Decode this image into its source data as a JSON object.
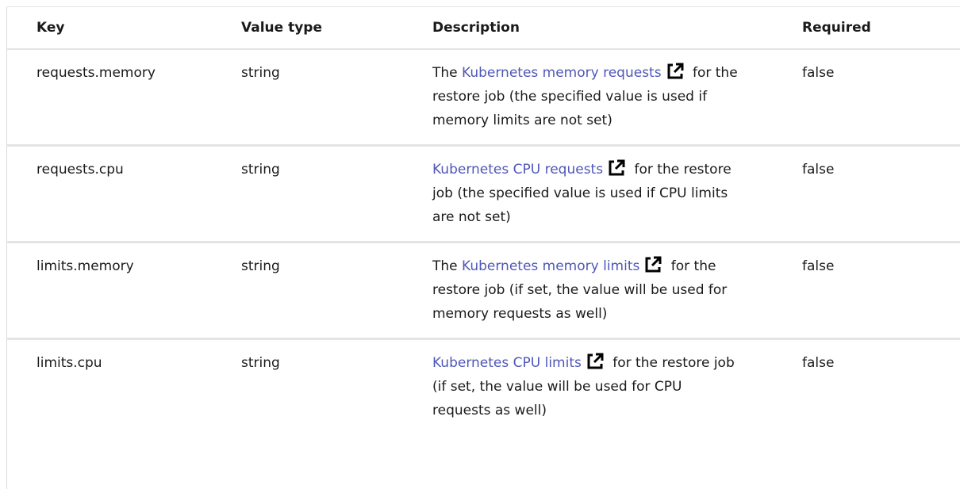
{
  "table": {
    "headers": {
      "key": "Key",
      "value_type": "Value type",
      "description": "Description",
      "required": "Required"
    },
    "rows": [
      {
        "key": "requests.memory",
        "value_type": "string",
        "desc_prefix": "The ",
        "link_text": "Kubernetes memory requests",
        "desc_suffix": " for the restore job (the specified value is used if memory limits are not set)",
        "required": "false"
      },
      {
        "key": "requests.cpu",
        "value_type": "string",
        "desc_prefix": "",
        "link_text": "Kubernetes CPU requests",
        "desc_suffix": " for the restore job (the specified value is used if CPU limits are not set)",
        "required": "false"
      },
      {
        "key": "limits.memory",
        "value_type": "string",
        "desc_prefix": "The ",
        "link_text": "Kubernetes memory limits",
        "desc_suffix": " for the restore job (if set, the value will be used for memory requests as well)",
        "required": "false"
      },
      {
        "key": "limits.cpu",
        "value_type": "string",
        "desc_prefix": "",
        "link_text": "Kubernetes CPU limits",
        "desc_suffix": " for the restore job (if set, the value will be used for CPU requests as well)",
        "required": "false"
      }
    ]
  },
  "icons": {
    "external_link": "external-link-icon"
  },
  "colors": {
    "link": "#4f57b8",
    "text": "#1a1a1a",
    "divider": "#e4e4e4"
  }
}
